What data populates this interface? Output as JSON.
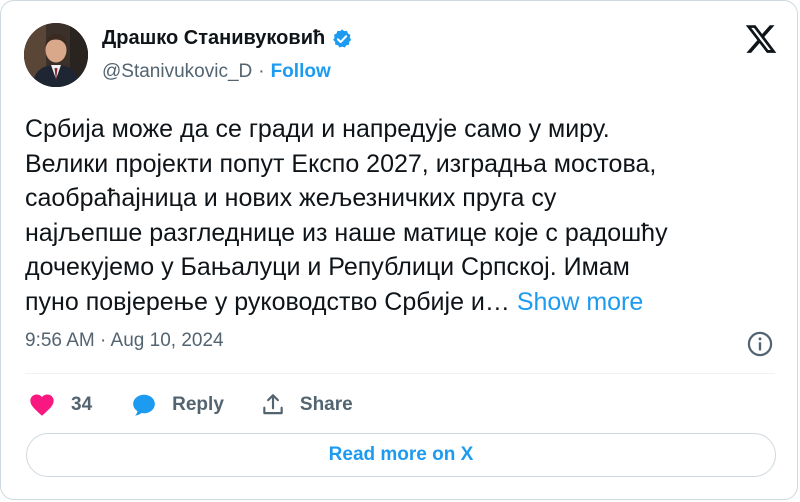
{
  "author": {
    "name": "Драшко Станивуковић",
    "handle": "@Stanivukovic_D",
    "separator": "·",
    "follow_label": "Follow"
  },
  "tweet": {
    "lines": [
      "Србија може да се гради и напредује само у миру.",
      "Велики пројекти попут Експо 2027, изградња мостова,",
      "саобраћајница и нових жељезничких пруга су",
      "најљепше разгледнице из наше матице које с радошћу",
      "дочекујемо у Бањалуци и Републици Српској. Имам",
      "пуно повјерење у руководство Србије и…"
    ],
    "show_more_label": "Show more",
    "timestamp": "9:56 AM · Aug 10, 2024"
  },
  "actions": {
    "likes_count": "34",
    "reply_label": "Reply",
    "share_label": "Share"
  },
  "read_more_label": "Read more on X",
  "colors": {
    "accent": "#1d9bf0",
    "like": "#f91880",
    "text": "#0f1419",
    "secondary": "#536471",
    "border": "#cfd9de"
  },
  "icons": {
    "verified": "verified-badge-icon",
    "logo": "x-logo-icon",
    "info": "info-icon",
    "like": "heart-icon",
    "reply": "reply-bubble-icon",
    "share": "share-icon"
  }
}
